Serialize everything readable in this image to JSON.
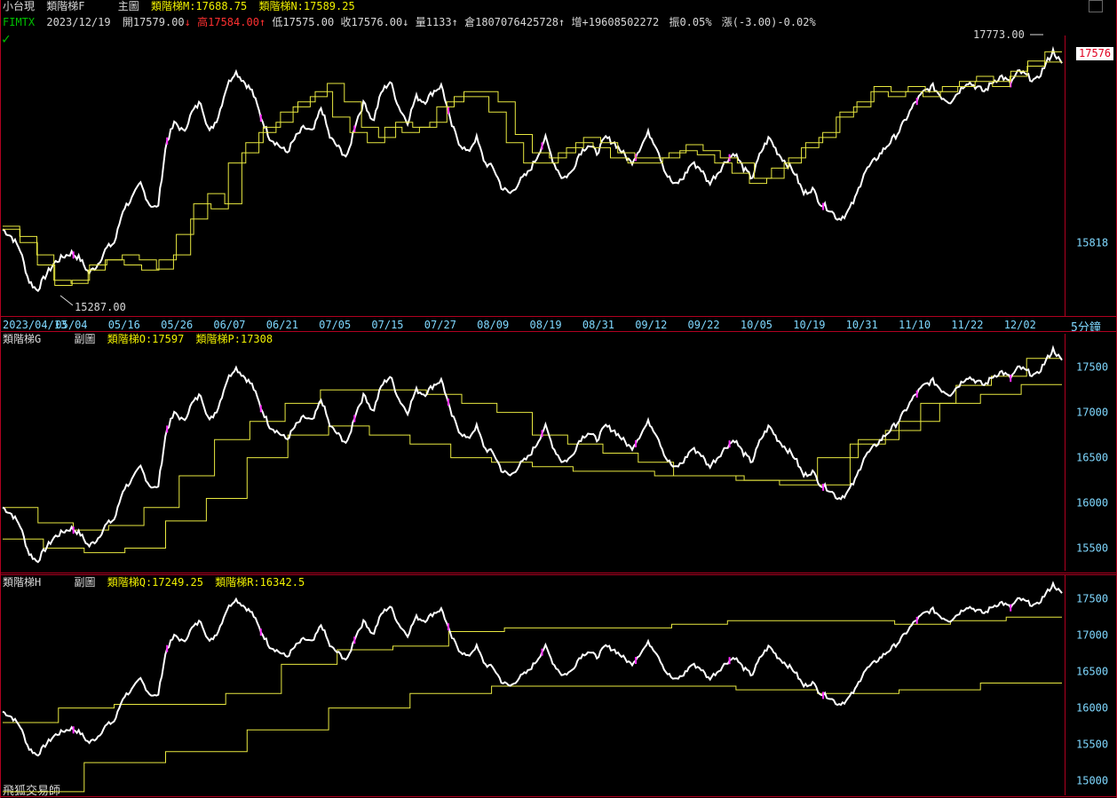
{
  "header": {
    "symbol": "小台現",
    "indicator_main": "類階梯F",
    "panel_label": "主圖",
    "m_label": "類階梯M:17688.75",
    "n_label": "類階梯N:17589.25",
    "ticker": "FIMTX",
    "date": "2023/12/19",
    "open": "開17579.00",
    "open_arrow": "↓",
    "high": "高17584.00",
    "high_arrow": "↑",
    "low": "低17575.00",
    "close": "收17576.00",
    "close_arrow": "↓",
    "volume": "量1133",
    "volume_arrow": "↑",
    "oi": "倉1807076425728",
    "oi_arrow": "↑",
    "increase": "增+19608502272",
    "amplitude": "振0.05%",
    "change": "漲(-3.00)-0.02%"
  },
  "panel2": {
    "name": "類階梯G",
    "label": "副圖",
    "o_label": "類階梯O:17597",
    "p_label": "類階梯P:17308"
  },
  "panel3": {
    "name": "類階梯H",
    "label": "副圖",
    "q_label": "類階梯Q:17249.25",
    "r_label": "類階梯R:16342.5"
  },
  "footer": {
    "watermark": "飛狐交易師",
    "interval": "5分鐘"
  },
  "annotations": {
    "high_value": "17773.00",
    "low_value": "15287.00",
    "last_price": "17576"
  },
  "colors": {
    "price": "#ffffff",
    "ladder": "#e8e840",
    "axis": "#b00020",
    "label": "#7fd8ff",
    "highlight": "#ff30ff"
  },
  "chart_data": [
    {
      "type": "line",
      "title": "主圖",
      "x": [
        "2023/04/13",
        "05/04",
        "05/16",
        "05/26",
        "06/07",
        "06/21",
        "07/05",
        "07/15",
        "07/27",
        "08/09",
        "08/19",
        "08/31",
        "09/12",
        "09/22",
        "10/05",
        "10/19",
        "10/31",
        "11/10",
        "11/22",
        "12/02"
      ],
      "yticks": [
        15818
      ],
      "ylim": [
        15100,
        17850
      ],
      "series": [
        {
          "name": "",
          "values": [
            15950,
            15880,
            15760,
            15450,
            15350,
            15500,
            15620,
            15680,
            15720,
            15660,
            15520,
            15600,
            15760,
            15820,
            16150,
            16250,
            16400,
            16200,
            16150,
            16800,
            17000,
            16900,
            17100,
            17200,
            16900,
            17050,
            17350,
            17500,
            17400,
            17300,
            17050,
            16850,
            16780,
            16700,
            16850,
            16950,
            16900,
            17150,
            16850,
            16750,
            16650,
            17000,
            17200,
            17000,
            17300,
            17400,
            17150,
            17000,
            17250,
            17200,
            17300,
            17360,
            17000,
            16800,
            16700,
            16850,
            16600,
            16550,
            16350,
            16300,
            16420,
            16500,
            16650,
            16850,
            16600,
            16450,
            16500,
            16700,
            16780,
            16700,
            16850,
            16800,
            16700,
            16600,
            16750,
            16900,
            16750,
            16500,
            16380,
            16450,
            16600,
            16550,
            16400,
            16500,
            16620,
            16700,
            16550,
            16450,
            16700,
            16850,
            16700,
            16600,
            16500,
            16300,
            16350,
            16200,
            16150,
            16050,
            16100,
            16250,
            16500,
            16600,
            16700,
            16800,
            16900,
            17050,
            17200,
            17300,
            17350,
            17250,
            17200,
            17300,
            17400,
            17350,
            17300,
            17400,
            17450,
            17380,
            17500,
            17450,
            17400,
            17550,
            17700,
            17560
          ]
        },
        {
          "name": "類階梯M",
          "values": [
            15980,
            15880,
            15700,
            15450,
            15420,
            15550,
            15650,
            15700,
            15650,
            15560,
            15700,
            16050,
            16300,
            16200,
            16700,
            16900,
            17000,
            17150,
            17250,
            17380,
            17200,
            16950,
            16850,
            17000,
            16950,
            17000,
            17200,
            17300,
            17300,
            17200,
            16880,
            16700,
            16650,
            16750,
            16850,
            16800,
            16700,
            16650,
            16650,
            16700,
            16780,
            16720,
            16650,
            16600,
            16450,
            16550,
            16650,
            16800,
            16900,
            17100,
            17200,
            17350,
            17300,
            17350,
            17300,
            17350,
            17400,
            17450,
            17400,
            17500,
            17600,
            17690
          ]
        },
        {
          "name": "類階梯N",
          "values": [
            15950,
            15820,
            15600,
            15400,
            15450,
            15600,
            15650,
            15600,
            15550,
            15650,
            15900,
            16200,
            16150,
            16600,
            16800,
            16950,
            17100,
            17200,
            17300,
            17050,
            16900,
            16800,
            16950,
            16900,
            16950,
            17150,
            17250,
            17250,
            17100,
            16800,
            16600,
            16600,
            16700,
            16800,
            16750,
            16650,
            16600,
            16600,
            16650,
            16720,
            16680,
            16600,
            16500,
            16400,
            16450,
            16600,
            16750,
            16850,
            17050,
            17150,
            17300,
            17250,
            17300,
            17250,
            17300,
            17350,
            17400,
            17350,
            17450,
            17550,
            17590
          ]
        }
      ]
    },
    {
      "type": "line",
      "title": "副圖",
      "yticks": [
        15500,
        16000,
        16500,
        17000,
        17500
      ],
      "ylim": [
        15250,
        17850
      ],
      "series": [
        {
          "name": "類階梯O",
          "values": [
            15950,
            15780,
            15700,
            15750,
            15950,
            16300,
            16700,
            16900,
            17100,
            17250,
            17250,
            17250,
            17200,
            17100,
            17000,
            16750,
            16650,
            16550,
            16450,
            16300,
            16300,
            16250,
            16200,
            16200,
            16650,
            16800,
            17100,
            17300,
            17400,
            17597
          ]
        },
        {
          "name": "類階梯P",
          "values": [
            15600,
            15500,
            15450,
            15500,
            15800,
            16050,
            16500,
            16750,
            16850,
            16750,
            16650,
            16500,
            16450,
            16400,
            16350,
            16350,
            16300,
            16300,
            16250,
            16250,
            16500,
            16700,
            16900,
            17100,
            17200,
            17308
          ]
        }
      ]
    },
    {
      "type": "line",
      "title": "副圖",
      "yticks": [
        15000,
        15500,
        16000,
        16500,
        17000,
        17500
      ],
      "ylim": [
        14800,
        17800
      ],
      "series": [
        {
          "name": "類階梯Q",
          "values": [
            15800,
            16000,
            16050,
            16050,
            16200,
            16600,
            16800,
            16850,
            17050,
            17100,
            17100,
            17100,
            17150,
            17200,
            17200,
            17200,
            17150,
            17200,
            17249.25
          ]
        },
        {
          "name": "類階梯R",
          "values": [
            14850,
            15250,
            15400,
            15700,
            16000,
            16200,
            16300,
            16300,
            16300,
            16250,
            16200,
            16250,
            16342.5
          ]
        }
      ]
    }
  ]
}
